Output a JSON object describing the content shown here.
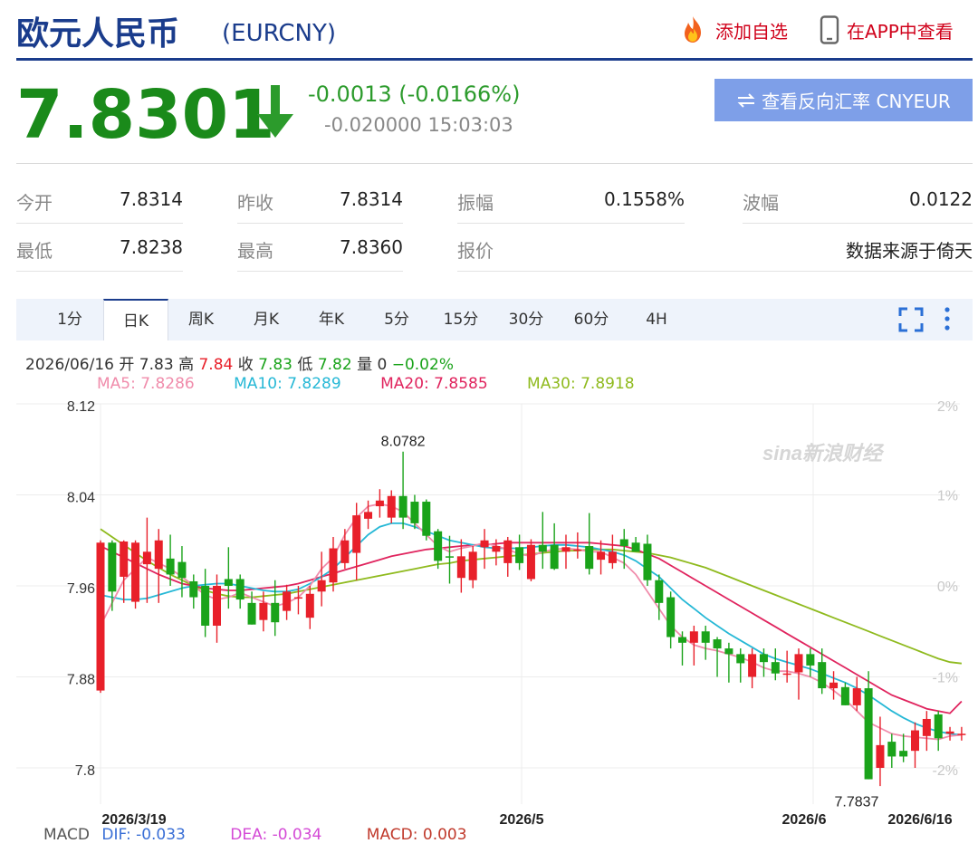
{
  "header": {
    "title": "欧元人民币",
    "code": "(EURCNY)",
    "add_favorite": "添加自选",
    "view_in_app": "在APP中查看"
  },
  "price": {
    "last": "7.8301",
    "change": "-0.0013 (-0.0166%)",
    "change2": "-0.020000 15:03:03",
    "reverse_button": "查看反向汇率 CNYEUR"
  },
  "quote": [
    {
      "label": "今开",
      "value": "7.8314"
    },
    {
      "label": "昨收",
      "value": "7.8314"
    },
    {
      "label": "振幅",
      "value": "0.1558%"
    },
    {
      "label": "波幅",
      "value": "0.0122"
    },
    {
      "label": "最低",
      "value": "7.8238"
    },
    {
      "label": "最高",
      "value": "7.8360"
    },
    {
      "label": "报价",
      "value": ""
    },
    {
      "label": "",
      "value": "数据来源于倚天"
    }
  ],
  "tabs": [
    "1分",
    "日K",
    "周K",
    "月K",
    "年K",
    "5分",
    "15分",
    "30分",
    "60分",
    "4H"
  ],
  "active_tab": "日K",
  "ohlc": {
    "date": "2026/06/16",
    "open_label": "开",
    "open": "7.83",
    "high_label": "高",
    "high": "7.84",
    "close_label": "收",
    "close": "7.83",
    "low_label": "低",
    "low": "7.82",
    "vol_label": "量",
    "vol": "0",
    "pct": "−0.02%"
  },
  "ma": {
    "ma5": "MA5: 7.8286",
    "ma10": "MA10: 7.8289",
    "ma20": "MA20: 7.8585",
    "ma30": "MA30: 7.8918"
  },
  "macd": {
    "label": "MACD",
    "dif": "DIF: -0.033",
    "dea": "DEA: -0.034",
    "macd": "MACD: 0.003"
  },
  "colors": {
    "up": "#e8202a",
    "down": "#1aa31a",
    "ma5": "#f08cab",
    "ma10": "#26b8d6",
    "ma20": "#e0245e",
    "ma30": "#8fba1e",
    "brand": "#1a3c8c"
  },
  "watermark": "sina新浪财经",
  "chart_data": {
    "type": "candlestick",
    "y_ticks": [
      "8.12",
      "8.04",
      "7.96",
      "7.88",
      "7.8"
    ],
    "ylim": [
      7.76,
      8.12
    ],
    "pct_ticks": [
      "2%",
      "1%",
      "0%",
      "-1%",
      "-2%"
    ],
    "x_labels": [
      "2026/3/19",
      "2026/5",
      "2026/6",
      "2026/6/16"
    ],
    "annotations": [
      "8.0782",
      "7.7837"
    ],
    "annotation_values": [
      8.0782,
      7.7837
    ],
    "candles": [
      {
        "o": 7.868,
        "h": 8.0,
        "l": 7.866,
        "c": 7.998
      },
      {
        "o": 7.998,
        "h": 8.0,
        "l": 7.938,
        "c": 7.955
      },
      {
        "o": 7.968,
        "h": 8.0,
        "l": 7.945,
        "c": 7.999
      },
      {
        "o": 7.946,
        "h": 8.0,
        "l": 7.94,
        "c": 7.998
      },
      {
        "o": 7.979,
        "h": 8.02,
        "l": 7.945,
        "c": 7.99
      },
      {
        "o": 7.975,
        "h": 8.01,
        "l": 7.945,
        "c": 8.0
      },
      {
        "o": 7.984,
        "h": 8.005,
        "l": 7.96,
        "c": 7.97
      },
      {
        "o": 7.981,
        "h": 7.995,
        "l": 7.95,
        "c": 7.967
      },
      {
        "o": 7.964,
        "h": 7.97,
        "l": 7.94,
        "c": 7.95
      },
      {
        "o": 7.96,
        "h": 7.975,
        "l": 7.915,
        "c": 7.925
      },
      {
        "o": 7.925,
        "h": 7.97,
        "l": 7.91,
        "c": 7.96
      },
      {
        "o": 7.966,
        "h": 7.994,
        "l": 7.94,
        "c": 7.96
      },
      {
        "o": 7.966,
        "h": 7.97,
        "l": 7.94,
        "c": 7.948
      },
      {
        "o": 7.945,
        "h": 7.955,
        "l": 7.926,
        "c": 7.926
      },
      {
        "o": 7.93,
        "h": 7.955,
        "l": 7.92,
        "c": 7.945
      },
      {
        "o": 7.945,
        "h": 7.965,
        "l": 7.916,
        "c": 7.928
      },
      {
        "o": 7.938,
        "h": 7.961,
        "l": 7.93,
        "c": 7.955
      },
      {
        "o": 7.949,
        "h": 7.96,
        "l": 7.935,
        "c": 7.95
      },
      {
        "o": 7.932,
        "h": 7.96,
        "l": 7.922,
        "c": 7.953
      },
      {
        "o": 7.955,
        "h": 7.99,
        "l": 7.942,
        "c": 7.965
      },
      {
        "o": 7.963,
        "h": 8.003,
        "l": 7.955,
        "c": 7.993
      },
      {
        "o": 7.98,
        "h": 8.01,
        "l": 7.975,
        "c": 8.0
      },
      {
        "o": 7.989,
        "h": 8.033,
        "l": 7.965,
        "c": 8.022
      },
      {
        "o": 8.019,
        "h": 8.035,
        "l": 8.01,
        "c": 8.025
      },
      {
        "o": 8.03,
        "h": 8.045,
        "l": 8.02,
        "c": 8.035
      },
      {
        "o": 8.02,
        "h": 8.044,
        "l": 8.015,
        "c": 8.039
      },
      {
        "o": 8.039,
        "h": 8.078,
        "l": 8.01,
        "c": 8.02
      },
      {
        "o": 8.034,
        "h": 8.04,
        "l": 8.01,
        "c": 8.015
      },
      {
        "o": 8.034,
        "h": 8.036,
        "l": 8.0,
        "c": 8.004
      },
      {
        "o": 8.008,
        "h": 8.01,
        "l": 7.975,
        "c": 7.982
      },
      {
        "o": 7.986,
        "h": 8.004,
        "l": 7.962,
        "c": 7.985
      },
      {
        "o": 7.967,
        "h": 8.001,
        "l": 7.954,
        "c": 7.986
      },
      {
        "o": 7.965,
        "h": 7.995,
        "l": 7.958,
        "c": 7.99
      },
      {
        "o": 7.994,
        "h": 8.01,
        "l": 7.975,
        "c": 8.0
      },
      {
        "o": 7.99,
        "h": 8.001,
        "l": 7.978,
        "c": 7.995
      },
      {
        "o": 7.98,
        "h": 8.003,
        "l": 7.968,
        "c": 8.0
      },
      {
        "o": 7.994,
        "h": 8.005,
        "l": 7.974,
        "c": 7.98
      },
      {
        "o": 7.966,
        "h": 8.001,
        "l": 7.964,
        "c": 7.996
      },
      {
        "o": 7.996,
        "h": 8.025,
        "l": 7.975,
        "c": 7.99
      },
      {
        "o": 7.996,
        "h": 8.015,
        "l": 7.974,
        "c": 7.975
      },
      {
        "o": 7.99,
        "h": 8.005,
        "l": 7.975,
        "c": 7.994
      },
      {
        "o": 7.992,
        "h": 8.007,
        "l": 7.984,
        "c": 7.992
      },
      {
        "o": 7.995,
        "h": 8.024,
        "l": 7.97,
        "c": 7.975
      },
      {
        "o": 7.983,
        "h": 8.0,
        "l": 7.97,
        "c": 7.99
      },
      {
        "o": 7.98,
        "h": 8.005,
        "l": 7.975,
        "c": 7.99
      },
      {
        "o": 8.001,
        "h": 8.01,
        "l": 7.975,
        "c": 7.995
      },
      {
        "o": 7.998,
        "h": 8.003,
        "l": 7.99,
        "c": 7.99
      },
      {
        "o": 7.997,
        "h": 8.005,
        "l": 7.96,
        "c": 7.965
      },
      {
        "o": 7.965,
        "h": 7.97,
        "l": 7.93,
        "c": 7.945
      },
      {
        "o": 7.95,
        "h": 7.955,
        "l": 7.905,
        "c": 7.915
      },
      {
        "o": 7.915,
        "h": 7.92,
        "l": 7.89,
        "c": 7.91
      },
      {
        "o": 7.91,
        "h": 7.925,
        "l": 7.89,
        "c": 7.92
      },
      {
        "o": 7.92,
        "h": 7.925,
        "l": 7.895,
        "c": 7.91
      },
      {
        "o": 7.913,
        "h": 7.915,
        "l": 7.88,
        "c": 7.905
      },
      {
        "o": 7.905,
        "h": 7.91,
        "l": 7.875,
        "c": 7.9
      },
      {
        "o": 7.9,
        "h": 7.905,
        "l": 7.875,
        "c": 7.892
      },
      {
        "o": 7.88,
        "h": 7.905,
        "l": 7.87,
        "c": 7.9
      },
      {
        "o": 7.9,
        "h": 7.905,
        "l": 7.88,
        "c": 7.893
      },
      {
        "o": 7.893,
        "h": 7.905,
        "l": 7.877,
        "c": 7.883
      },
      {
        "o": 7.883,
        "h": 7.903,
        "l": 7.875,
        "c": 7.883
      },
      {
        "o": 7.884,
        "h": 7.905,
        "l": 7.86,
        "c": 7.9
      },
      {
        "o": 7.9,
        "h": 7.905,
        "l": 7.88,
        "c": 7.89
      },
      {
        "o": 7.893,
        "h": 7.905,
        "l": 7.865,
        "c": 7.87
      },
      {
        "o": 7.87,
        "h": 7.885,
        "l": 7.86,
        "c": 7.875
      },
      {
        "o": 7.871,
        "h": 7.875,
        "l": 7.855,
        "c": 7.855
      },
      {
        "o": 7.855,
        "h": 7.88,
        "l": 7.85,
        "c": 7.87
      },
      {
        "o": 7.87,
        "h": 7.885,
        "l": 7.79,
        "c": 7.79
      },
      {
        "o": 7.8,
        "h": 7.845,
        "l": 7.784,
        "c": 7.82
      },
      {
        "o": 7.823,
        "h": 7.83,
        "l": 7.8,
        "c": 7.81
      },
      {
        "o": 7.815,
        "h": 7.83,
        "l": 7.805,
        "c": 7.81
      },
      {
        "o": 7.815,
        "h": 7.84,
        "l": 7.8,
        "c": 7.833
      },
      {
        "o": 7.828,
        "h": 7.85,
        "l": 7.815,
        "c": 7.843
      },
      {
        "o": 7.847,
        "h": 7.85,
        "l": 7.815,
        "c": 7.826
      },
      {
        "o": 7.83,
        "h": 7.836,
        "l": 7.824,
        "c": 7.832
      },
      {
        "o": 7.83,
        "h": 7.836,
        "l": 7.824,
        "c": 7.83
      }
    ],
    "ma_series": [
      {
        "name": "MA5",
        "values": [
          7.925,
          7.945,
          7.965,
          7.975,
          7.985,
          7.98,
          7.975,
          7.968,
          7.96,
          7.952,
          7.948,
          7.95,
          7.954,
          7.95,
          7.946,
          7.942,
          7.945,
          7.95,
          7.96,
          7.975,
          7.985,
          8.005,
          8.02,
          8.03,
          8.032,
          8.03,
          8.025,
          8.015,
          8.005,
          7.995,
          7.99,
          7.993,
          7.995,
          7.998,
          7.995,
          7.992,
          7.988,
          7.986,
          7.99,
          7.992,
          7.993,
          7.992,
          7.99,
          7.99,
          7.985,
          7.98,
          7.97,
          7.955,
          7.94,
          7.925,
          7.915,
          7.908,
          7.905,
          7.903,
          7.9,
          7.897,
          7.893,
          7.888,
          7.885,
          7.885,
          7.883,
          7.88,
          7.875,
          7.868,
          7.86,
          7.85,
          7.84,
          7.835,
          7.83,
          7.828,
          7.827,
          7.826,
          7.825,
          7.828,
          7.829
        ]
      },
      {
        "name": "MA10",
        "values": [
          7.952,
          7.95,
          7.948,
          7.948,
          7.949,
          7.952,
          7.955,
          7.958,
          7.96,
          7.961,
          7.962,
          7.962,
          7.96,
          7.958,
          7.956,
          7.955,
          7.955,
          7.957,
          7.962,
          7.968,
          7.975,
          7.985,
          7.995,
          8.005,
          8.012,
          8.015,
          8.015,
          8.012,
          8.008,
          8.004,
          8.0,
          7.998,
          7.996,
          7.994,
          7.993,
          7.993,
          7.993,
          7.994,
          7.995,
          7.996,
          7.996,
          7.995,
          7.994,
          7.992,
          7.99,
          7.987,
          7.982,
          7.975,
          7.968,
          7.958,
          7.948,
          7.94,
          7.932,
          7.925,
          7.918,
          7.912,
          7.906,
          7.9,
          7.896,
          7.893,
          7.89,
          7.887,
          7.883,
          7.879,
          7.875,
          7.87,
          7.864,
          7.857,
          7.85,
          7.844,
          7.839,
          7.835,
          7.832,
          7.83,
          7.829
        ]
      },
      {
        "name": "MA20",
        "values": [
          7.995,
          7.99,
          7.985,
          7.98,
          7.975,
          7.97,
          7.966,
          7.962,
          7.96,
          7.958,
          7.957,
          7.956,
          7.956,
          7.957,
          7.958,
          7.959,
          7.96,
          7.962,
          7.965,
          7.968,
          7.971,
          7.974,
          7.977,
          7.98,
          7.983,
          7.986,
          7.988,
          7.99,
          7.992,
          7.993,
          7.994,
          7.995,
          7.996,
          7.996,
          7.997,
          7.998,
          7.998,
          7.998,
          7.998,
          7.998,
          7.998,
          7.998,
          7.998,
          7.997,
          7.996,
          7.995,
          7.992,
          7.988,
          7.984,
          7.978,
          7.972,
          7.966,
          7.96,
          7.954,
          7.948,
          7.942,
          7.936,
          7.93,
          7.924,
          7.918,
          7.912,
          7.906,
          7.9,
          7.894,
          7.888,
          7.882,
          7.876,
          7.87,
          7.864,
          7.86,
          7.856,
          7.852,
          7.85,
          7.848,
          7.8585
        ]
      },
      {
        "name": "MA30",
        "values": [
          8.01,
          8.003,
          7.996,
          7.989,
          7.982,
          7.976,
          7.97,
          7.965,
          7.96,
          7.956,
          7.953,
          7.951,
          7.95,
          7.95,
          7.951,
          7.952,
          7.953,
          7.955,
          7.957,
          7.959,
          7.961,
          7.963,
          7.965,
          7.967,
          7.969,
          7.971,
          7.973,
          7.975,
          7.977,
          7.979,
          7.98,
          7.982,
          7.983,
          7.984,
          7.985,
          7.986,
          7.987,
          7.988,
          7.989,
          7.99,
          7.991,
          7.991,
          7.992,
          7.992,
          7.992,
          7.991,
          7.99,
          7.989,
          7.987,
          7.985,
          7.982,
          7.979,
          7.976,
          7.972,
          7.968,
          7.964,
          7.96,
          7.956,
          7.952,
          7.948,
          7.944,
          7.94,
          7.936,
          7.932,
          7.928,
          7.924,
          7.92,
          7.916,
          7.912,
          7.908,
          7.904,
          7.9,
          7.896,
          7.893,
          7.8918
        ]
      }
    ]
  }
}
